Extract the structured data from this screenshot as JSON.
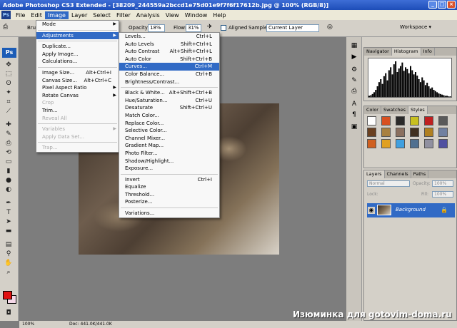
{
  "window": {
    "title": "Adobe Photoshop CS3 Extended - [38209_244559a2bccd1e75d01e9f7f6f17612b.jpg @ 100% (RGB/8)]",
    "buttons": [
      "_",
      "□",
      "×"
    ]
  },
  "menubar": {
    "logo": "Ps",
    "items": [
      "File",
      "Edit",
      "Image",
      "Layer",
      "Select",
      "Filter",
      "Analysis",
      "View",
      "Window",
      "Help"
    ],
    "active": "Image"
  },
  "options": {
    "brush_label": "Bru",
    "opacity_label": "Opacity:",
    "opacity_value": "18%",
    "flow_label": "Flow:",
    "flow_value": "31%",
    "aligned_label": "Aligned",
    "sample_label": "Sample:",
    "sample_value": "Current Layer",
    "workspace_label": "Workspace ▾"
  },
  "image_menu": {
    "items": [
      {
        "label": "Mode",
        "arrow": true
      },
      {
        "sep": true
      },
      {
        "label": "Adjustments",
        "arrow": true,
        "highlighted": true
      },
      {
        "sep": true
      },
      {
        "label": "Duplicate..."
      },
      {
        "label": "Apply Image..."
      },
      {
        "label": "Calculations..."
      },
      {
        "sep": true
      },
      {
        "label": "Image Size...",
        "shortcut": "Alt+Ctrl+I"
      },
      {
        "label": "Canvas Size...",
        "shortcut": "Alt+Ctrl+C"
      },
      {
        "label": "Pixel Aspect Ratio",
        "arrow": true
      },
      {
        "label": "Rotate Canvas",
        "arrow": true
      },
      {
        "label": "Crop",
        "disabled": true
      },
      {
        "label": "Trim..."
      },
      {
        "label": "Reveal All",
        "disabled": true
      },
      {
        "sep": true
      },
      {
        "label": "Variables",
        "arrow": true,
        "disabled": true
      },
      {
        "label": "Apply Data Set...",
        "disabled": true
      },
      {
        "sep": true
      },
      {
        "label": "Trap...",
        "disabled": true
      }
    ]
  },
  "adjustments_menu": {
    "items": [
      {
        "label": "Levels...",
        "shortcut": "Ctrl+L"
      },
      {
        "label": "Auto Levels",
        "shortcut": "Shift+Ctrl+L"
      },
      {
        "label": "Auto Contrast",
        "shortcut": "Alt+Shift+Ctrl+L"
      },
      {
        "label": "Auto Color",
        "shortcut": "Shift+Ctrl+B"
      },
      {
        "label": "Curves...",
        "shortcut": "Ctrl+M",
        "highlighted": true
      },
      {
        "label": "Color Balance...",
        "shortcut": "Ctrl+B"
      },
      {
        "label": "Brightness/Contrast..."
      },
      {
        "sep": true
      },
      {
        "label": "Black & White...",
        "shortcut": "Alt+Shift+Ctrl+B"
      },
      {
        "label": "Hue/Saturation...",
        "shortcut": "Ctrl+U"
      },
      {
        "label": "Desaturate",
        "shortcut": "Shift+Ctrl+U"
      },
      {
        "label": "Match Color..."
      },
      {
        "label": "Replace Color..."
      },
      {
        "label": "Selective Color..."
      },
      {
        "label": "Channel Mixer..."
      },
      {
        "label": "Gradient Map..."
      },
      {
        "label": "Photo Filter..."
      },
      {
        "label": "Shadow/Highlight..."
      },
      {
        "label": "Exposure..."
      },
      {
        "sep": true
      },
      {
        "label": "Invert",
        "shortcut": "Ctrl+I"
      },
      {
        "label": "Equalize"
      },
      {
        "label": "Threshold..."
      },
      {
        "label": "Posterize..."
      },
      {
        "sep": true
      },
      {
        "label": "Variations..."
      }
    ]
  },
  "panels": {
    "nav_tabs": [
      "Navigator",
      "Histogram",
      "Info"
    ],
    "nav_active": "Histogram",
    "histogram": [
      2,
      3,
      5,
      8,
      12,
      18,
      25,
      30,
      22,
      35,
      40,
      28,
      45,
      50,
      38,
      55,
      60,
      42,
      48,
      52,
      58,
      44,
      50,
      47,
      40,
      52,
      45,
      38,
      42,
      36,
      30,
      25,
      33,
      28,
      20,
      24,
      18,
      14,
      16,
      12,
      10,
      8,
      6,
      5,
      4,
      3,
      2,
      2,
      1,
      1
    ],
    "color_tabs": [
      "Color",
      "Swatches",
      "Styles"
    ],
    "color_active": "Styles",
    "styles": [
      "#ffffff",
      "#d85020",
      "#2a2a2a",
      "#c8c020",
      "#c02020",
      "#5a5a5a",
      "#6a4020",
      "#a88040",
      "#8a7060",
      "#403020",
      "#b08020",
      "#7080a0",
      "#d06020",
      "#e0a020",
      "#40a0e0",
      "#507090",
      "#9090a0",
      "#5050a0"
    ],
    "layers_tabs": [
      "Layers",
      "Channels",
      "Paths"
    ],
    "layers_active": "Layers",
    "blend_mode": "Normal",
    "opacity_label": "Opacity:",
    "opacity_value": "100%",
    "lock_label": "Lock:",
    "fill_label": "Fill:",
    "fill_value": "100%",
    "layer_name": "Background"
  },
  "status": {
    "zoom": "100%",
    "doc": "Doc: 441.0K/441.0K"
  },
  "watermark": "Изюминка для gotovim-doma.ru"
}
